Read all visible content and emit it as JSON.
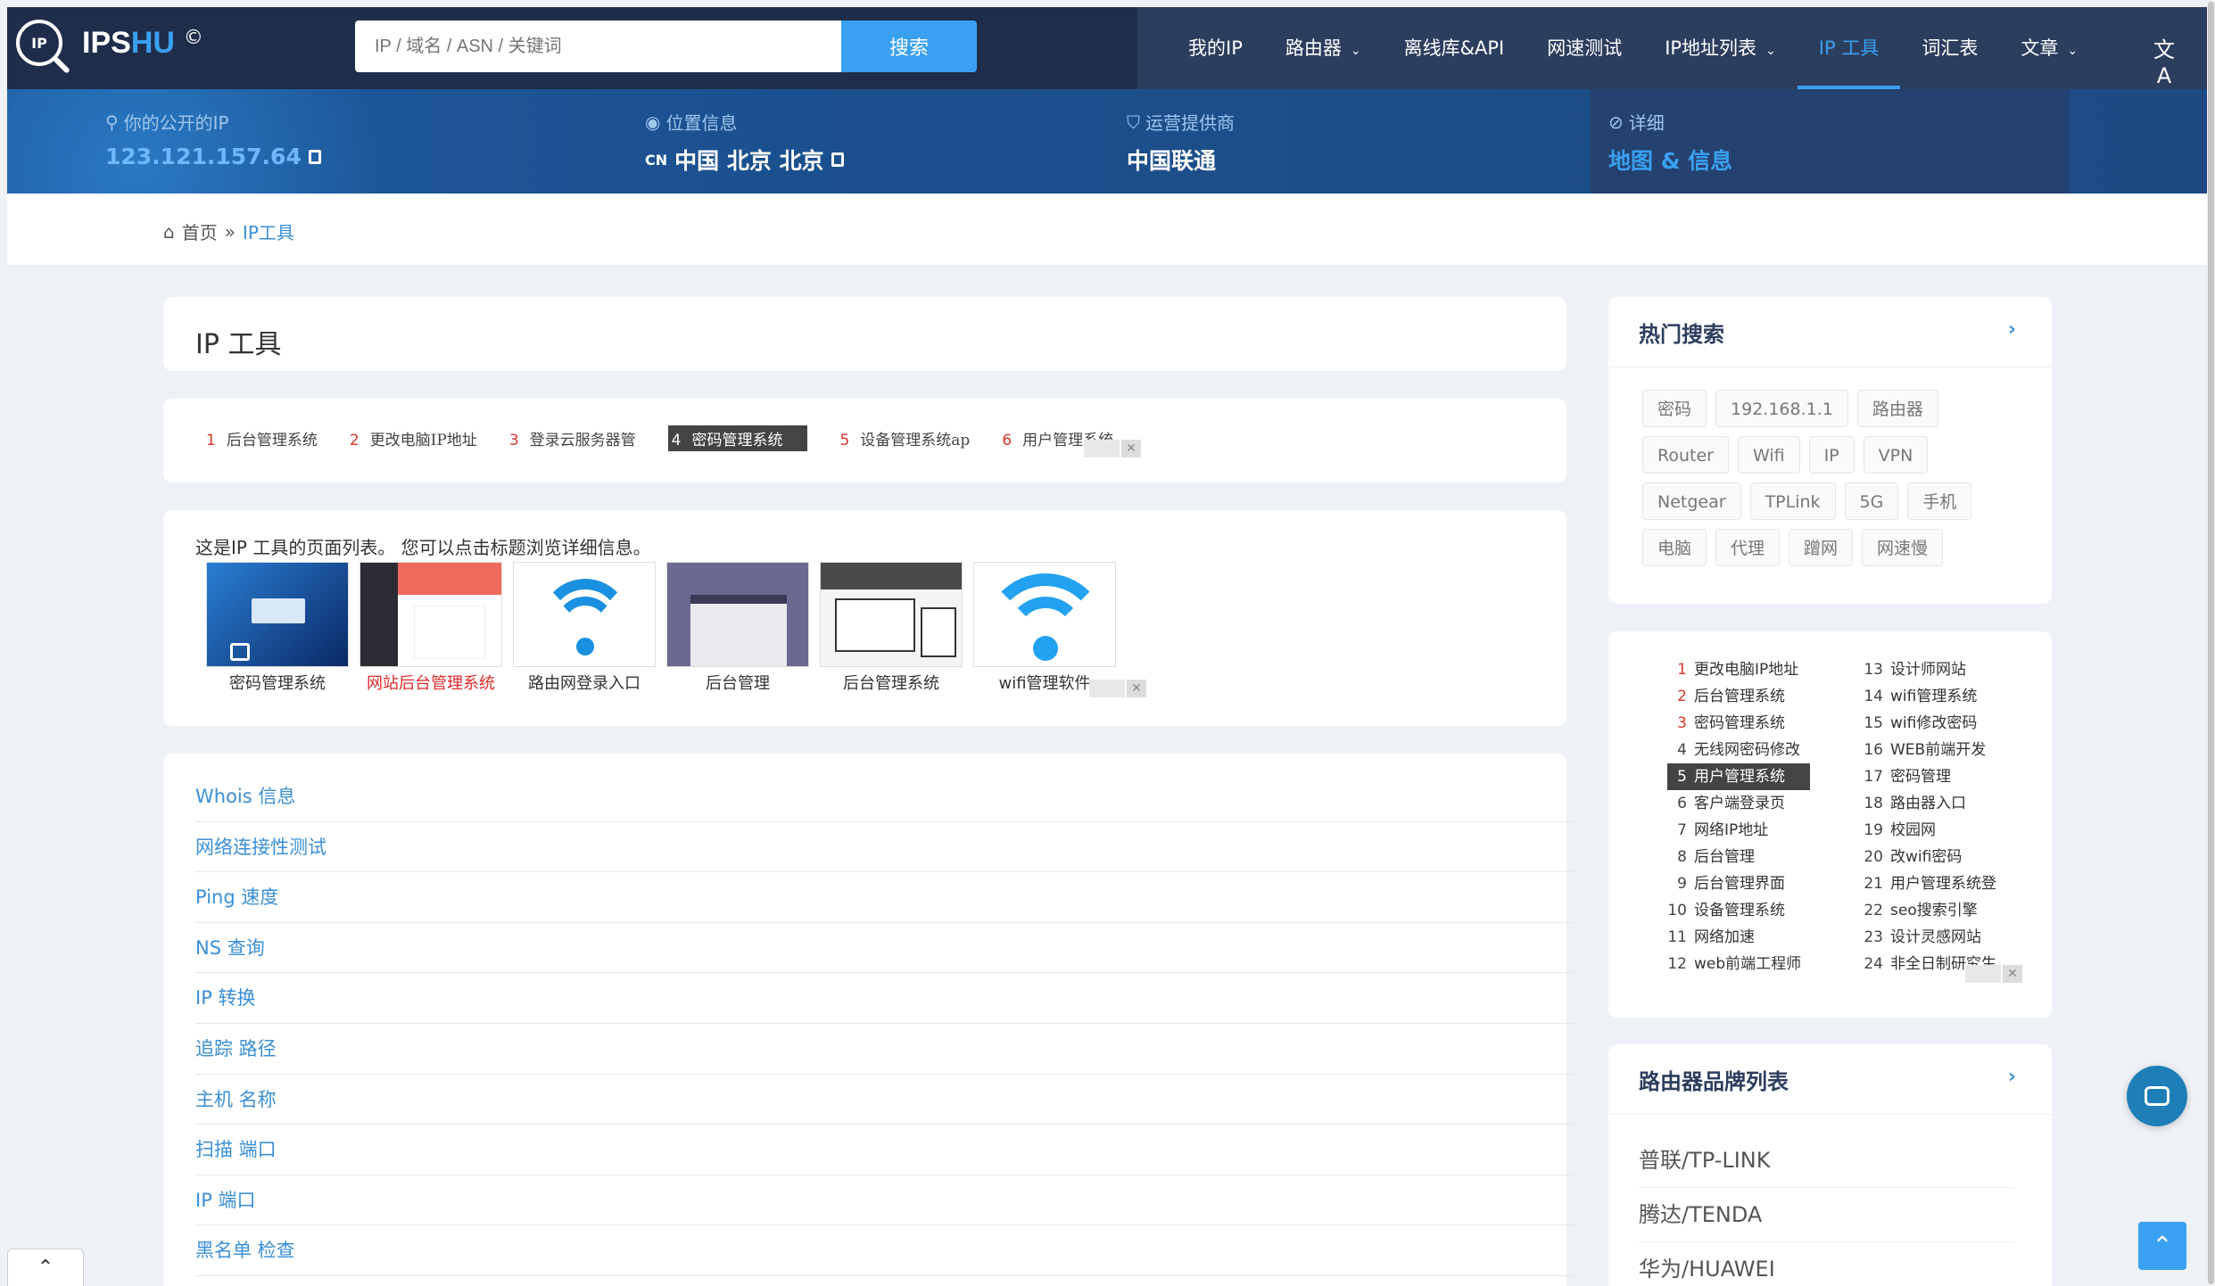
{
  "nav": {
    "brand": "IPSHU",
    "brand_copyright": "©",
    "search_placeholder": "IP / 域名 / ASN / 关键词",
    "search_button": "搜索",
    "menu": [
      {
        "label": "我的IP",
        "dropdown": false
      },
      {
        "label": "路由器",
        "dropdown": true
      },
      {
        "label": "离线库&API",
        "dropdown": false
      },
      {
        "label": "网速测试",
        "dropdown": false
      },
      {
        "label": "IP地址列表",
        "dropdown": true
      },
      {
        "label": "IP 工具",
        "dropdown": false,
        "active": true
      },
      {
        "label": "词汇表",
        "dropdown": false
      },
      {
        "label": "文章",
        "dropdown": true
      }
    ],
    "translate_icon": "文A"
  },
  "info": {
    "public_ip_label": "你的公开的IP",
    "public_ip_value": "123.121.157.64",
    "location_label": "位置信息",
    "location_cc": "CN",
    "location_value": "中国 北京 北京",
    "isp_label": "运营提供商",
    "isp_value": "中国联通",
    "detail_label": "详细",
    "detail_value": "地图 & 信息"
  },
  "breadcrumb": {
    "home": "首页",
    "sep": "»",
    "current": "IP工具"
  },
  "main": {
    "title": "IP 工具",
    "tabs": [
      {
        "num": "1",
        "label": "后台管理系统"
      },
      {
        "num": "2",
        "label": "更改电脑IP地址"
      },
      {
        "num": "3",
        "label": "登录云服务器管"
      },
      {
        "num": "4",
        "label": "密码管理系统",
        "highlight": true
      },
      {
        "num": "5",
        "label": "设备管理系统ap"
      },
      {
        "num": "6",
        "label": "用户管理系统"
      }
    ],
    "intro": "这是IP 工具的页面列表。 您可以点击标题浏览详细信息。",
    "thumbs": [
      {
        "caption": "密码管理系统",
        "red": false
      },
      {
        "caption": "网站后台管理系统",
        "red": true
      },
      {
        "caption": "路由网登录入口",
        "red": false
      },
      {
        "caption": "后台管理",
        "red": false
      },
      {
        "caption": "后台管理系统",
        "red": false
      },
      {
        "caption": "wifi管理软件",
        "red": false
      }
    ],
    "tools": [
      "Whois 信息",
      "网络连接性测试",
      "Ping 速度",
      "NS 查询",
      "IP 转换",
      "追踪 路径",
      "主机 名称",
      "扫描 端口",
      "IP 端口",
      "黑名单 检查"
    ]
  },
  "sidebar": {
    "hot_title": "热门搜索",
    "hot_tags": [
      "密码",
      "192.168.1.1",
      "路由器",
      "Router",
      "Wifi",
      "IP",
      "VPN",
      "Netgear",
      "TPLink",
      "5G",
      "手机",
      "电脑",
      "代理",
      "蹭网",
      "网速慢"
    ],
    "rank_left": [
      {
        "n": "1",
        "label": "更改电脑IP地址"
      },
      {
        "n": "2",
        "label": "后台管理系统"
      },
      {
        "n": "3",
        "label": "密码管理系统"
      },
      {
        "n": "4",
        "label": "无线网密码修改"
      },
      {
        "n": "5",
        "label": "用户管理系统",
        "highlight": true
      },
      {
        "n": "6",
        "label": "客户端登录页"
      },
      {
        "n": "7",
        "label": "网络IP地址"
      },
      {
        "n": "8",
        "label": "后台管理"
      },
      {
        "n": "9",
        "label": "后台管理界面"
      },
      {
        "n": "10",
        "label": "设备管理系统"
      },
      {
        "n": "11",
        "label": "网络加速"
      },
      {
        "n": "12",
        "label": "web前端工程师"
      }
    ],
    "rank_right": [
      {
        "n": "13",
        "label": "设计师网站"
      },
      {
        "n": "14",
        "label": "wifi管理系统"
      },
      {
        "n": "15",
        "label": "wifi修改密码"
      },
      {
        "n": "16",
        "label": "WEB前端开发"
      },
      {
        "n": "17",
        "label": "密码管理"
      },
      {
        "n": "18",
        "label": "路由器入口"
      },
      {
        "n": "19",
        "label": "校园网"
      },
      {
        "n": "20",
        "label": "改wifi密码"
      },
      {
        "n": "21",
        "label": "用户管理系统登"
      },
      {
        "n": "22",
        "label": "seo搜索引擎"
      },
      {
        "n": "23",
        "label": "设计灵感网站"
      },
      {
        "n": "24",
        "label": "非全日制研究生"
      }
    ],
    "brand_title": "路由器品牌列表",
    "brands": [
      "普联/TP-LINK",
      "腾达/TENDA",
      "华为/HUAWEI"
    ],
    "arrow": "›"
  },
  "colors": {
    "nav_bg": "#2c3e5e",
    "accent": "#3aa0f0",
    "link": "#3a8fd6",
    "rank_red": "#d9362b"
  }
}
